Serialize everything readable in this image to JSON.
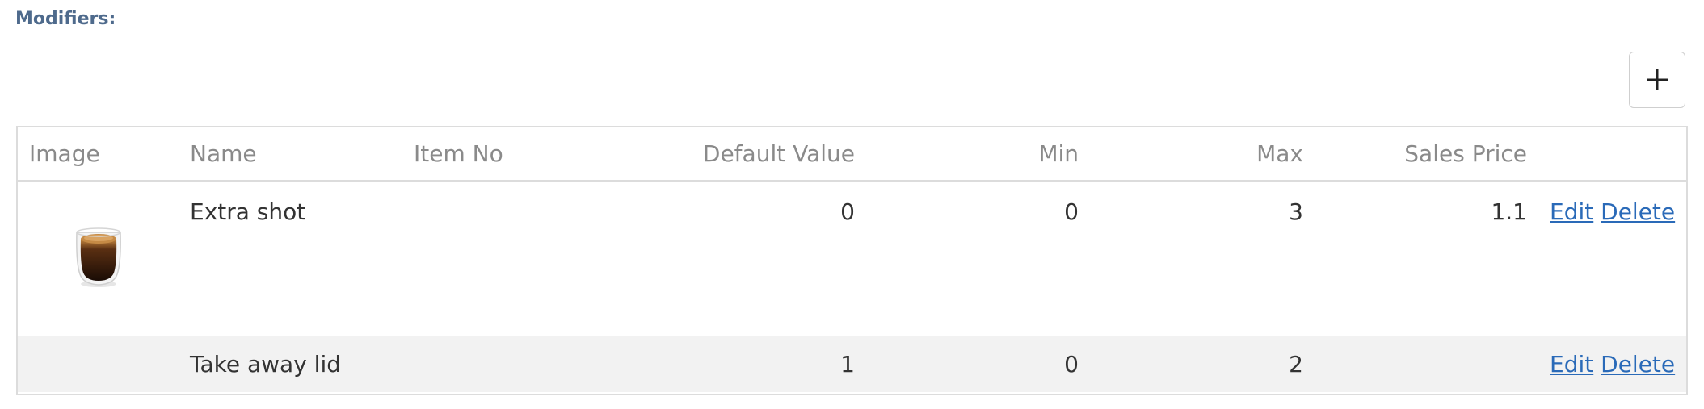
{
  "section": {
    "title": "Modifiers:"
  },
  "toolbar": {
    "add_icon": "plus-icon"
  },
  "table": {
    "headers": {
      "image": "Image",
      "name": "Name",
      "item_no": "Item No",
      "default_value": "Default Value",
      "min": "Min",
      "max": "Max",
      "sales_price": "Sales Price"
    },
    "rows": [
      {
        "image": "espresso-cup-image",
        "name": "Extra shot",
        "item_no": "",
        "default_value": "0",
        "min": "0",
        "max": "3",
        "sales_price": "1.1",
        "edit_label": "Edit",
        "delete_label": "Delete"
      },
      {
        "image": "",
        "name": "Take away lid",
        "item_no": "",
        "default_value": "1",
        "min": "0",
        "max": "2",
        "sales_price": "",
        "edit_label": "Edit",
        "delete_label": "Delete"
      }
    ]
  },
  "colors": {
    "title": "#4e6a8c",
    "link": "#2a6ab8",
    "header_text": "#8a8a8a",
    "alt_row": "#f2f2f2"
  }
}
